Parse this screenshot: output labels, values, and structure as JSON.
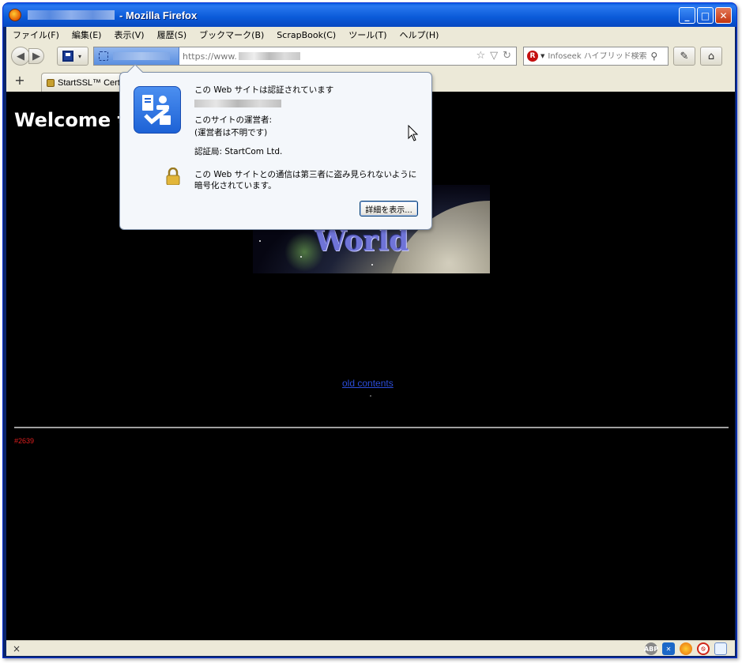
{
  "window": {
    "title": "- Mozilla Firefox",
    "minimize_label": "_",
    "maximize_label": "□",
    "close_label": "✕"
  },
  "menubar": {
    "items": [
      "ファイル(F)",
      "編集(E)",
      "表示(V)",
      "履歴(S)",
      "ブックマーク(B)",
      "ScrapBook(C)",
      "ツール(T)",
      "ヘルプ(H)"
    ]
  },
  "navbar": {
    "url_prefix": "https://www.",
    "search_placeholder": "Infoseek ハイブリッド検索",
    "search_engine_icon": "R"
  },
  "tabs": {
    "new_tab_label": "+",
    "active_tab_label": "StartSSL™ Cert"
  },
  "identity_popup": {
    "heading": "この Web サイトは認証されています",
    "owner_label": "このサイトの運営者:",
    "owner_value": "(運営者は不明です)",
    "verifier": "認証局: StartCom Ltd.",
    "encryption_note": "この Web サイトとの通信は第三者に盗み見られないように暗号化されています。",
    "more_info_button": "詳細を表示..."
  },
  "page": {
    "welcome_heading": "Welcome to",
    "banner_text": "World",
    "old_contents_link": "old contents",
    "counter": "#2639"
  },
  "statusbar": {
    "close_label": "×",
    "icons": [
      "adblock-icon",
      "grid-icon",
      "firefox-icon",
      "block-icon",
      "page-icon"
    ]
  },
  "colors": {
    "titlebar": "#0a5ad8",
    "content_bg": "#000000",
    "link": "#2b4cd8",
    "counter": "#e01e1e",
    "identity_box": "#5a8fe0"
  }
}
